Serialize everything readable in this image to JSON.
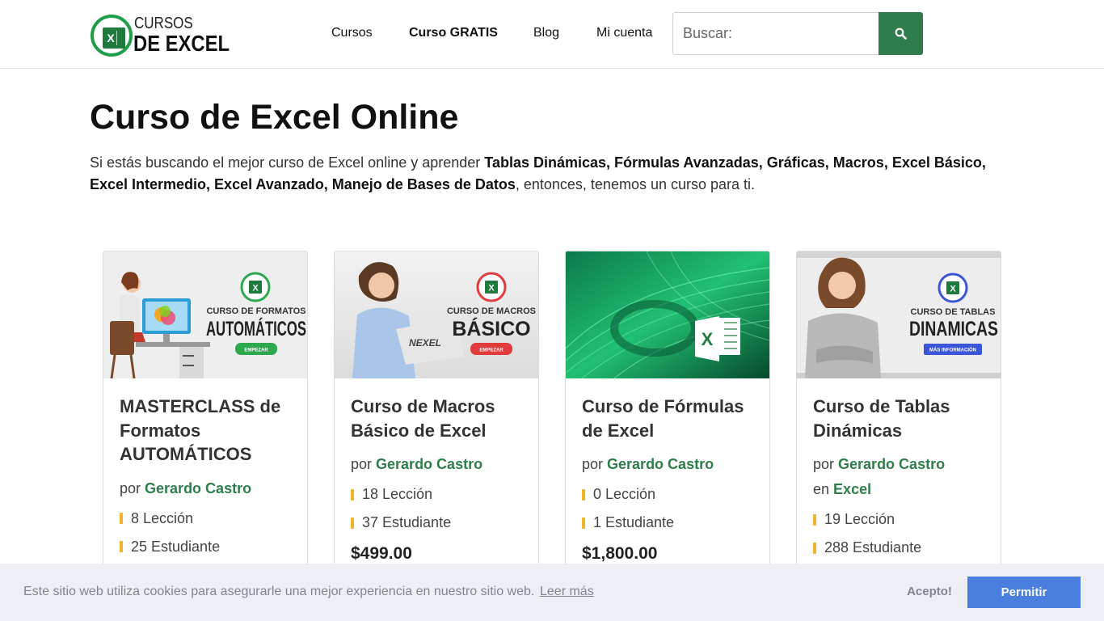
{
  "header": {
    "logo": {
      "line1": "CURSOS",
      "line2": "DE EXCEL",
      "sheet_letter": "X"
    },
    "nav": [
      {
        "label": "Cursos"
      },
      {
        "label": "Curso GRATIS"
      },
      {
        "label": "Blog"
      },
      {
        "label": "Mi cuenta"
      }
    ],
    "search": {
      "placeholder": "Buscar:",
      "icon": "search-icon"
    }
  },
  "main": {
    "title": "Curso de Excel Online",
    "intro_pre": "Si estás buscando el mejor curso de Excel online y aprender ",
    "intro_bold": "Tablas Dinámicas, Fórmulas Avanzadas, Gráficas, Macros, Excel Básico, Excel Intermedio, Excel Avanzado, Manejo de Bases de Datos",
    "intro_post": ", entonces, tenemos un curso para ti."
  },
  "cards": [
    {
      "title": "MASTERCLASS de Formatos AUTOMÁTICOS",
      "by": "por",
      "author": "Gerardo Castro",
      "lessons": "8 Lección",
      "students": "25 Estudiante",
      "image": {
        "small": "CURSO DE FORMATOS",
        "big": "AUTOMÁTICOS",
        "button": "EMPEZAR",
        "button_color": "#2ea84f"
      }
    },
    {
      "title": "Curso de Macros Básico de Excel",
      "by": "por",
      "author": "Gerardo Castro",
      "lessons": "18 Lección",
      "students": "37 Estudiante",
      "price": "$499.00",
      "image": {
        "small": "CURSO DE MACROS",
        "big": "BÁSICO",
        "button": "EMPEZAR",
        "button_color": "#e23b3b",
        "laptop": "NEXEL"
      }
    },
    {
      "title": "Curso de Fórmulas de Excel",
      "by": "por",
      "author": "Gerardo Castro",
      "lessons": "0 Lección",
      "students": "1 Estudiante",
      "price": "$1,800.00",
      "image": {
        "letter": "X"
      }
    },
    {
      "title": "Curso de Tablas Dinámicas",
      "by": "por",
      "author": "Gerardo Castro",
      "in": "en",
      "category": "Excel",
      "lessons": "19 Lección",
      "students": "288 Estudiante",
      "image": {
        "small": "CURSO DE TABLAS",
        "big": "DINAMICAS",
        "button": "MÁS INFORMACIÓN",
        "button_color": "#3b55d9"
      }
    }
  ],
  "cookie": {
    "message": "Este sitio web utiliza cookies para asegurarle una mejor experiencia en nuestro sitio web.",
    "learn_more": "Leer más",
    "accept": "Acepto!",
    "allow": "Permitir"
  },
  "colors": {
    "brand_green": "#2e7d4a",
    "cookie_button": "#4a7fe0",
    "bullet": "#f0b429"
  }
}
